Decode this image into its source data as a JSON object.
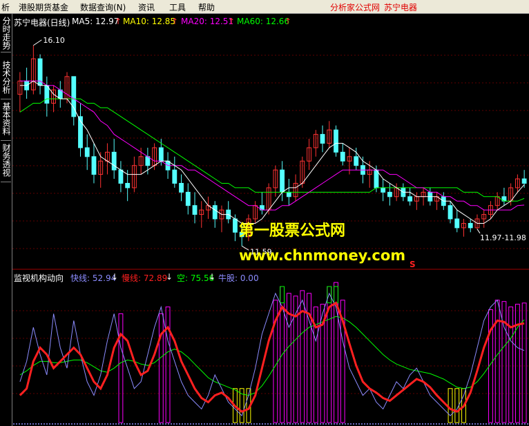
{
  "menu": {
    "items": [
      "析",
      "港股期货基金",
      "数据查询(N)",
      "资讯",
      "工具",
      "帮助"
    ],
    "app_title": "分析家公式网",
    "stock_title": "苏宁电器"
  },
  "sidebar": {
    "tabs": [
      {
        "label": "分时走势"
      },
      {
        "label": "技术分析"
      },
      {
        "label": "基本资料"
      },
      {
        "label": "财务透视"
      }
    ]
  },
  "upper_panel": {
    "title": "苏宁电器(日线)",
    "ma5": "MA5: 12.97",
    "ma10": "MA10: 12.85",
    "ma20": "MA20: 12.51",
    "ma60": "MA60: 12.66",
    "arrow": "↑",
    "high_label": "16.10",
    "low_label": "11.59",
    "range_label": "11.97-11.98",
    "s_marker": "S"
  },
  "lower_panel": {
    "title": "监视机构动向",
    "fast": "快线: 52.94",
    "slow": "慢线: 72.89",
    "empty": "空: 75.56",
    "bull": "牛股: 0.00",
    "down_arrow": "↓"
  },
  "watermark": {
    "line1": "第一股票公式网",
    "line2": "www.chnmoney.com"
  },
  "colors": {
    "up_candle": "#ff3232",
    "down_candle": "#54ffff",
    "ma5": "#ffffff",
    "ma10": "#ffff00",
    "ma20": "#ff00ff",
    "ma60": "#00ff00",
    "fast_line": "#8c8cff",
    "slow_line": "#ff2020",
    "empty_line": "#00ff00",
    "bars": "#ff00ff",
    "yellow_box": "#ffff00",
    "green_box": "#00ff00"
  },
  "chart_data": {
    "type": "candlestick",
    "price_range": [
      11.3,
      16.5
    ],
    "oscillator_range": [
      0,
      100
    ],
    "candles": [
      [
        15.0,
        15.5,
        14.6,
        15.3
      ],
      [
        15.3,
        15.6,
        14.9,
        15.1
      ],
      [
        15.1,
        16.1,
        15.0,
        15.8
      ],
      [
        15.8,
        15.9,
        15.0,
        15.2
      ],
      [
        15.2,
        15.4,
        14.5,
        14.8
      ],
      [
        14.8,
        15.2,
        14.6,
        15.1
      ],
      [
        15.1,
        15.3,
        14.7,
        14.9
      ],
      [
        14.9,
        15.5,
        14.8,
        15.4
      ],
      [
        15.4,
        15.4,
        14.3,
        14.5
      ],
      [
        14.5,
        14.8,
        13.6,
        13.8
      ],
      [
        13.8,
        14.1,
        13.3,
        13.6
      ],
      [
        13.6,
        13.9,
        13.0,
        13.2
      ],
      [
        13.2,
        13.7,
        12.9,
        13.5
      ],
      [
        13.5,
        13.9,
        13.2,
        13.7
      ],
      [
        13.7,
        14.0,
        13.1,
        13.3
      ],
      [
        13.3,
        13.5,
        12.8,
        13.0
      ],
      [
        13.0,
        13.3,
        12.6,
        12.9
      ],
      [
        12.9,
        13.6,
        12.8,
        13.4
      ],
      [
        13.4,
        13.8,
        13.2,
        13.6
      ],
      [
        13.6,
        13.8,
        13.2,
        13.4
      ],
      [
        13.4,
        13.9,
        13.3,
        13.8
      ],
      [
        13.8,
        14.0,
        13.4,
        13.5
      ],
      [
        13.5,
        13.7,
        13.1,
        13.3
      ],
      [
        13.3,
        13.6,
        12.9,
        13.0
      ],
      [
        13.0,
        13.2,
        12.6,
        12.8
      ],
      [
        12.8,
        13.0,
        12.3,
        12.5
      ],
      [
        12.5,
        12.8,
        12.1,
        12.3
      ],
      [
        12.3,
        12.6,
        12.0,
        12.4
      ],
      [
        12.4,
        12.7,
        12.2,
        12.5
      ],
      [
        12.5,
        12.6,
        12.0,
        12.2
      ],
      [
        12.2,
        12.5,
        11.9,
        12.4
      ],
      [
        12.4,
        12.6,
        12.1,
        12.2
      ],
      [
        12.2,
        12.3,
        11.7,
        11.9
      ],
      [
        11.9,
        12.1,
        11.59,
        11.8
      ],
      [
        11.8,
        12.3,
        11.7,
        12.2
      ],
      [
        12.2,
        12.6,
        12.1,
        12.5
      ],
      [
        12.5,
        12.8,
        12.3,
        12.4
      ],
      [
        12.4,
        13.0,
        12.3,
        12.9
      ],
      [
        12.9,
        13.4,
        12.7,
        13.3
      ],
      [
        13.3,
        13.5,
        12.6,
        12.8
      ],
      [
        12.8,
        13.1,
        12.5,
        12.7
      ],
      [
        12.7,
        13.2,
        12.6,
        13.0
      ],
      [
        13.0,
        13.6,
        12.9,
        13.5
      ],
      [
        13.5,
        14.0,
        13.3,
        13.8
      ],
      [
        13.8,
        14.2,
        13.6,
        14.1
      ],
      [
        14.1,
        14.3,
        13.7,
        13.9
      ],
      [
        13.9,
        14.4,
        13.8,
        14.2
      ],
      [
        14.2,
        14.3,
        13.6,
        13.7
      ],
      [
        13.7,
        13.9,
        13.4,
        13.5
      ],
      [
        13.5,
        13.8,
        13.2,
        13.6
      ],
      [
        13.6,
        13.8,
        13.3,
        13.4
      ],
      [
        13.4,
        13.6,
        13.0,
        13.2
      ],
      [
        13.2,
        13.5,
        12.9,
        13.3
      ],
      [
        13.3,
        13.4,
        12.8,
        12.9
      ],
      [
        12.9,
        13.1,
        12.6,
        12.8
      ],
      [
        12.8,
        13.0,
        12.5,
        12.7
      ],
      [
        12.7,
        13.0,
        12.6,
        12.9
      ],
      [
        12.9,
        13.0,
        12.6,
        12.7
      ],
      [
        12.7,
        12.9,
        12.5,
        12.6
      ],
      [
        12.6,
        12.8,
        12.4,
        12.7
      ],
      [
        12.7,
        12.9,
        12.5,
        12.8
      ],
      [
        12.8,
        12.9,
        12.5,
        12.6
      ],
      [
        12.6,
        12.8,
        12.4,
        12.7
      ],
      [
        12.7,
        12.8,
        12.4,
        12.5
      ],
      [
        12.5,
        12.6,
        12.1,
        12.2
      ],
      [
        12.2,
        12.4,
        11.9,
        12.0
      ],
      [
        12.0,
        12.2,
        11.8,
        12.1
      ],
      [
        12.1,
        12.2,
        11.9,
        12.0
      ],
      [
        12.0,
        12.3,
        11.97,
        12.2
      ],
      [
        12.2,
        12.4,
        12.0,
        12.3
      ],
      [
        12.3,
        12.6,
        12.2,
        12.5
      ],
      [
        12.5,
        12.8,
        12.4,
        12.7
      ],
      [
        12.7,
        12.9,
        12.5,
        12.6
      ],
      [
        12.6,
        13.0,
        12.5,
        12.9
      ],
      [
        12.9,
        13.2,
        12.8,
        13.1
      ],
      [
        13.1,
        13.3,
        12.9,
        13.0
      ]
    ],
    "ma5": [
      15.2,
      15.2,
      15.3,
      15.2,
      15.2,
      15.0,
      14.9,
      14.9,
      14.7,
      14.4,
      14.2,
      13.9,
      13.6,
      13.5,
      13.4,
      13.3,
      13.2,
      13.2,
      13.2,
      13.3,
      13.4,
      13.5,
      13.5,
      13.4,
      13.3,
      13.1,
      12.9,
      12.7,
      12.5,
      12.4,
      12.3,
      12.3,
      12.2,
      12.1,
      12.1,
      12.1,
      12.2,
      12.4,
      12.6,
      12.8,
      12.9,
      12.9,
      13.0,
      13.2,
      13.4,
      13.6,
      13.8,
      13.9,
      13.9,
      13.8,
      13.7,
      13.5,
      13.4,
      13.3,
      13.1,
      13.0,
      12.9,
      12.8,
      12.8,
      12.7,
      12.7,
      12.7,
      12.7,
      12.6,
      12.6,
      12.4,
      12.3,
      12.2,
      12.1,
      12.1,
      12.2,
      12.4,
      12.5,
      12.6,
      12.8,
      12.97
    ],
    "ma20": [
      15.3,
      15.3,
      15.3,
      15.3,
      15.2,
      15.2,
      15.1,
      15.0,
      14.9,
      14.8,
      14.7,
      14.6,
      14.4,
      14.3,
      14.1,
      14.0,
      13.9,
      13.8,
      13.7,
      13.6,
      13.5,
      13.5,
      13.4,
      13.4,
      13.4,
      13.3,
      13.3,
      13.2,
      13.1,
      13.0,
      12.9,
      12.8,
      12.7,
      12.6,
      12.5,
      12.5,
      12.4,
      12.4,
      12.4,
      12.5,
      12.5,
      12.6,
      12.7,
      12.8,
      12.9,
      13.0,
      13.1,
      13.2,
      13.3,
      13.3,
      13.3,
      13.3,
      13.3,
      13.3,
      13.3,
      13.2,
      13.2,
      13.1,
      13.0,
      12.9,
      12.9,
      12.8,
      12.8,
      12.7,
      12.7,
      12.6,
      12.6,
      12.5,
      12.5,
      12.4,
      12.4,
      12.4,
      12.4,
      12.4,
      12.5,
      12.51
    ],
    "ma60": [
      14.6,
      14.7,
      14.8,
      14.8,
      14.9,
      14.9,
      14.9,
      14.9,
      14.9,
      14.9,
      14.8,
      14.8,
      14.7,
      14.7,
      14.6,
      14.5,
      14.4,
      14.3,
      14.2,
      14.1,
      14.0,
      13.9,
      13.8,
      13.7,
      13.6,
      13.5,
      13.4,
      13.3,
      13.2,
      13.1,
      13.0,
      13.0,
      12.9,
      12.9,
      12.9,
      12.8,
      12.8,
      12.8,
      12.8,
      12.8,
      12.8,
      12.8,
      12.8,
      12.8,
      12.8,
      12.8,
      12.8,
      12.8,
      12.8,
      12.8,
      12.8,
      12.8,
      12.8,
      12.9,
      12.9,
      12.9,
      12.9,
      12.9,
      12.9,
      12.9,
      12.9,
      12.9,
      12.9,
      12.9,
      12.9,
      12.9,
      12.8,
      12.8,
      12.8,
      12.7,
      12.7,
      12.7,
      12.6,
      12.6,
      12.6,
      12.66
    ],
    "fast": [
      30,
      45,
      70,
      50,
      35,
      80,
      55,
      40,
      75,
      50,
      30,
      20,
      35,
      60,
      80,
      55,
      40,
      25,
      30,
      50,
      70,
      85,
      60,
      45,
      30,
      20,
      15,
      10,
      20,
      35,
      25,
      15,
      10,
      5,
      20,
      40,
      65,
      80,
      95,
      85,
      70,
      80,
      90,
      75,
      60,
      80,
      95,
      85,
      60,
      40,
      30,
      20,
      25,
      15,
      10,
      20,
      30,
      25,
      35,
      40,
      30,
      20,
      15,
      10,
      5,
      10,
      20,
      35,
      55,
      75,
      85,
      90,
      70,
      60,
      55,
      52.94
    ],
    "slow": [
      20,
      25,
      45,
      55,
      50,
      40,
      45,
      50,
      55,
      50,
      40,
      30,
      25,
      35,
      55,
      65,
      60,
      45,
      35,
      38,
      50,
      65,
      70,
      60,
      45,
      35,
      25,
      18,
      15,
      20,
      22,
      18,
      12,
      8,
      10,
      20,
      40,
      60,
      75,
      85,
      80,
      78,
      82,
      80,
      70,
      72,
      85,
      88,
      75,
      58,
      42,
      30,
      25,
      22,
      18,
      16,
      20,
      24,
      28,
      32,
      30,
      26,
      20,
      15,
      10,
      8,
      12,
      22,
      38,
      55,
      68,
      75,
      74,
      70,
      72,
      72.89
    ],
    "empty": [
      35,
      38,
      42,
      45,
      45,
      44,
      44,
      45,
      46,
      46,
      44,
      41,
      38,
      37,
      40,
      44,
      46,
      45,
      43,
      42,
      44,
      48,
      52,
      54,
      52,
      48,
      43,
      38,
      33,
      30,
      28,
      26,
      24,
      21,
      20,
      22,
      27,
      34,
      42,
      50,
      56,
      61,
      66,
      70,
      72,
      74,
      76,
      78,
      77,
      74,
      70,
      65,
      60,
      55,
      50,
      46,
      43,
      41,
      39,
      38,
      37,
      36,
      34,
      32,
      29,
      26,
      25,
      26,
      30,
      36,
      43,
      50,
      56,
      62,
      70,
      75.56
    ]
  }
}
